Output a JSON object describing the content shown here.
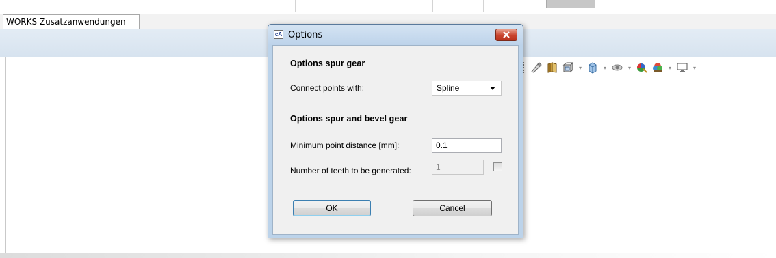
{
  "app": {
    "tab_label": "WORKS Zusatzanwendungen",
    "toolbar_icons": [
      "pencil-wrench-icon",
      "book-icon",
      "section-view-icon",
      "display-style-icon",
      "hide-show-icon",
      "appearance-icon",
      "scene-icon",
      "monitor-icon"
    ]
  },
  "dialog": {
    "icon_text": "cA",
    "title": "Options",
    "section1_title": "Options spur gear",
    "connect_label": "Connect points with:",
    "connect_value": "Spline",
    "section2_title": "Options spur and bevel gear",
    "min_distance_label": "Minimum point distance [mm]:",
    "min_distance_value": "0.1",
    "teeth_label": "Number of teeth to be generated:",
    "teeth_value": "1",
    "teeth_checkbox_checked": false,
    "ok_label": "OK",
    "cancel_label": "Cancel"
  },
  "colors": {
    "dialog_frame": "#bcd3ea",
    "close_button": "#c9452f",
    "default_button_border": "#3c7fb1"
  }
}
